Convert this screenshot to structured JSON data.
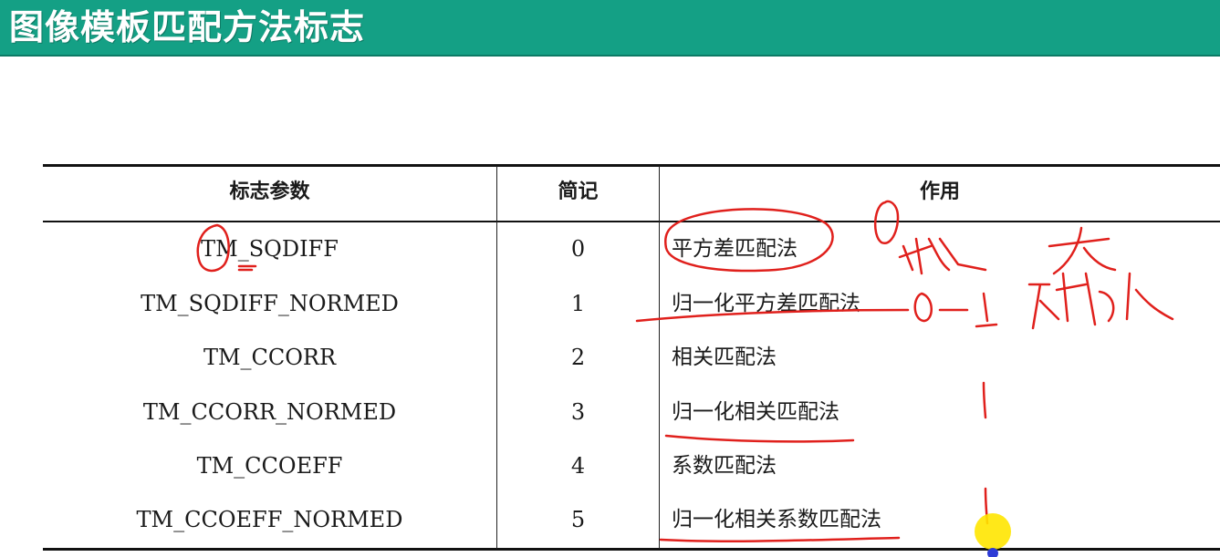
{
  "header": {
    "title": "图像模板匹配方法标志"
  },
  "table": {
    "headers": [
      "标志参数",
      "简记",
      "作用"
    ],
    "rows": [
      {
        "flag": "TM_SQDIFF",
        "code": "0",
        "desc": "平方差匹配法"
      },
      {
        "flag": "TM_SQDIFF_NORMED",
        "code": "1",
        "desc": "归一化平方差匹配法"
      },
      {
        "flag": "TM_CCORR",
        "code": "2",
        "desc": "相关匹配法"
      },
      {
        "flag": "TM_CCORR_NORMED",
        "code": "3",
        "desc": "归一化相关匹配法"
      },
      {
        "flag": "TM_CCOEFF",
        "code": "4",
        "desc": "系数匹配法"
      },
      {
        "flag": "TM_CCOEFF_NORMED",
        "code": "5",
        "desc": "归一化相关系数匹配法"
      }
    ]
  },
  "colors": {
    "header_bg": "#14a085",
    "ink": "#e0201c",
    "cursor": "#ffe600"
  }
}
